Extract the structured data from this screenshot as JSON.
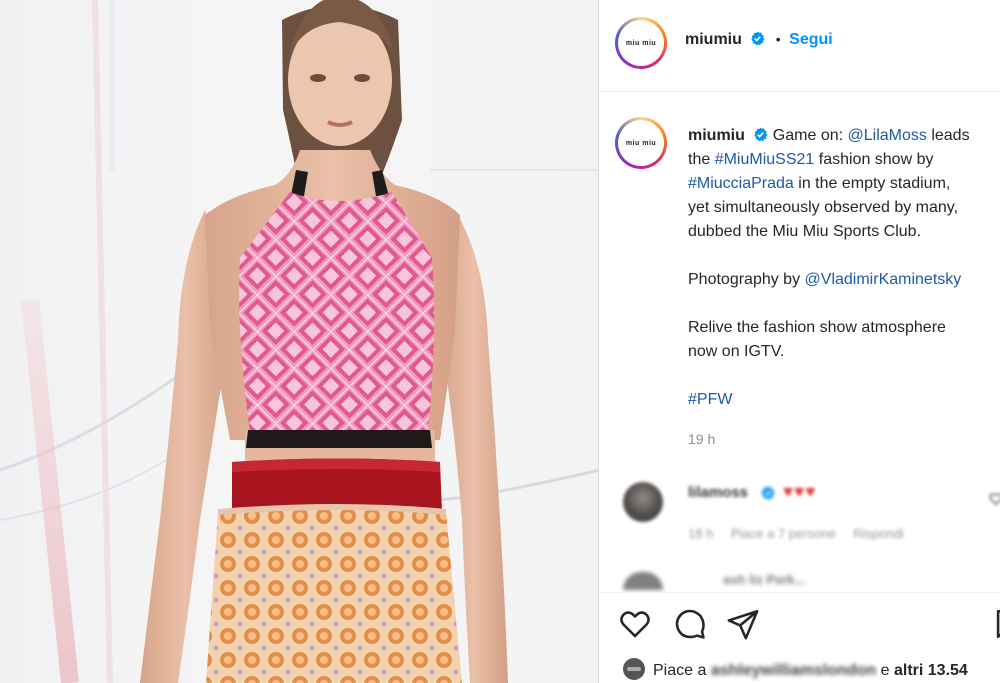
{
  "post": {
    "account": {
      "username": "miumiu",
      "avatar_text": "miu miu",
      "verified_icon": "verified-badge-icon",
      "follow_separator": "•",
      "follow_label": "Segui"
    },
    "caption": {
      "username": "miumiu",
      "lines": [
        {
          "text": "Game on: "
        },
        {
          "mention": "@LilaMoss"
        },
        {
          "text": " leads"
        }
      ],
      "line1_a": "Game on: ",
      "line1_mention": "@LilaMoss",
      "line1_b": " leads",
      "line2_a": "the ",
      "line2_tag": "#MiuMiuSS21",
      "line2_b": " fashion show by",
      "line3_tag": "#MiucciaPrada",
      "line3_b": " in the empty stadium,",
      "line4": "yet simultaneously observed by many,",
      "line5": "dubbed the Miu Miu Sports Club.",
      "line6_a": "Photography by ",
      "line6_mention": "@VladimirKaminetsky",
      "line7": "Relive the fashion show atmosphere",
      "line8": "now on IGTV.",
      "line9_tag": "#PFW"
    },
    "timestamp": "19 h",
    "comment": {
      "username": "lilamoss",
      "emojis": "♥♥♥",
      "meta_time": "18 h",
      "meta_likes": "Piace a 7 persone",
      "meta_reply": "Rispondi"
    },
    "peek_text": "ash liz Park... ",
    "actions": {
      "like_icon": "heart-icon",
      "comment_icon": "comment-icon",
      "share_icon": "paper-plane-icon",
      "save_icon": "bookmark-icon"
    },
    "likes": {
      "prefix": "Piace a ",
      "liker": "ashleywilliamslondon",
      "connector": " e ",
      "others": "altri 13.54"
    }
  },
  "colors": {
    "link": "#1e5aa8",
    "follow": "#0095f6",
    "muted": "#8e8e8e",
    "top_pink": "#e66fa3",
    "skirt_orange": "#e9a064",
    "waistband_red": "#a8141e"
  }
}
